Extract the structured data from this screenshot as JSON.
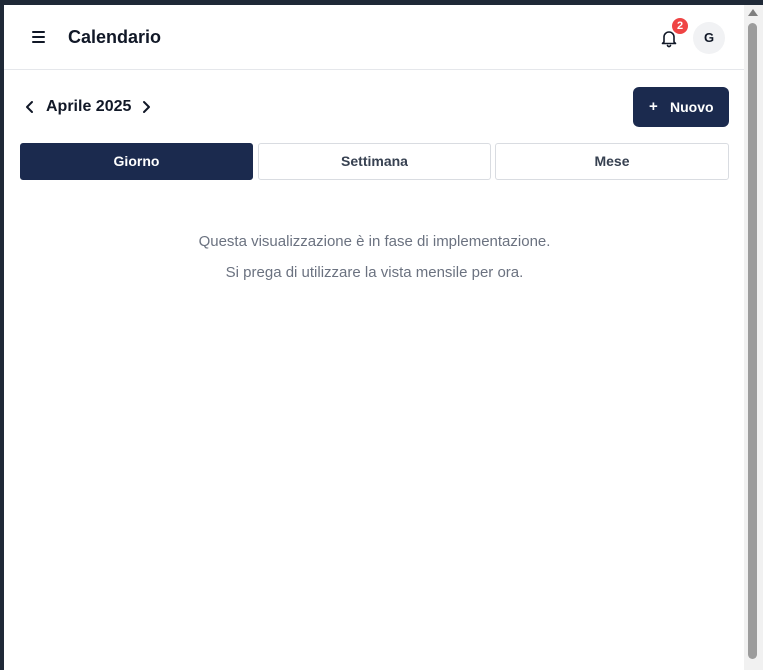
{
  "header": {
    "title": "Calendario",
    "notification_count": "2",
    "avatar_initial": "G",
    "menu_icon": "hamburger-menu-icon",
    "bell_icon": "bell-icon"
  },
  "toolbar": {
    "month_label": "Aprile 2025",
    "prev_icon": "chevron-left-icon",
    "next_icon": "chevron-right-icon",
    "new_button": {
      "icon": "+",
      "label": "Nuovo"
    }
  },
  "view_tabs": [
    {
      "label": "Giorno",
      "active": true
    },
    {
      "label": "Settimana",
      "active": false
    },
    {
      "label": "Mese",
      "active": false
    }
  ],
  "content": {
    "line1": "Questa visualizzazione è in fase di implementazione.",
    "line2": "Si prega di utilizzare la vista mensile per ora."
  },
  "colors": {
    "primary": "#1b2a4e",
    "badge": "#ef4444",
    "muted_text": "#6b7280"
  }
}
